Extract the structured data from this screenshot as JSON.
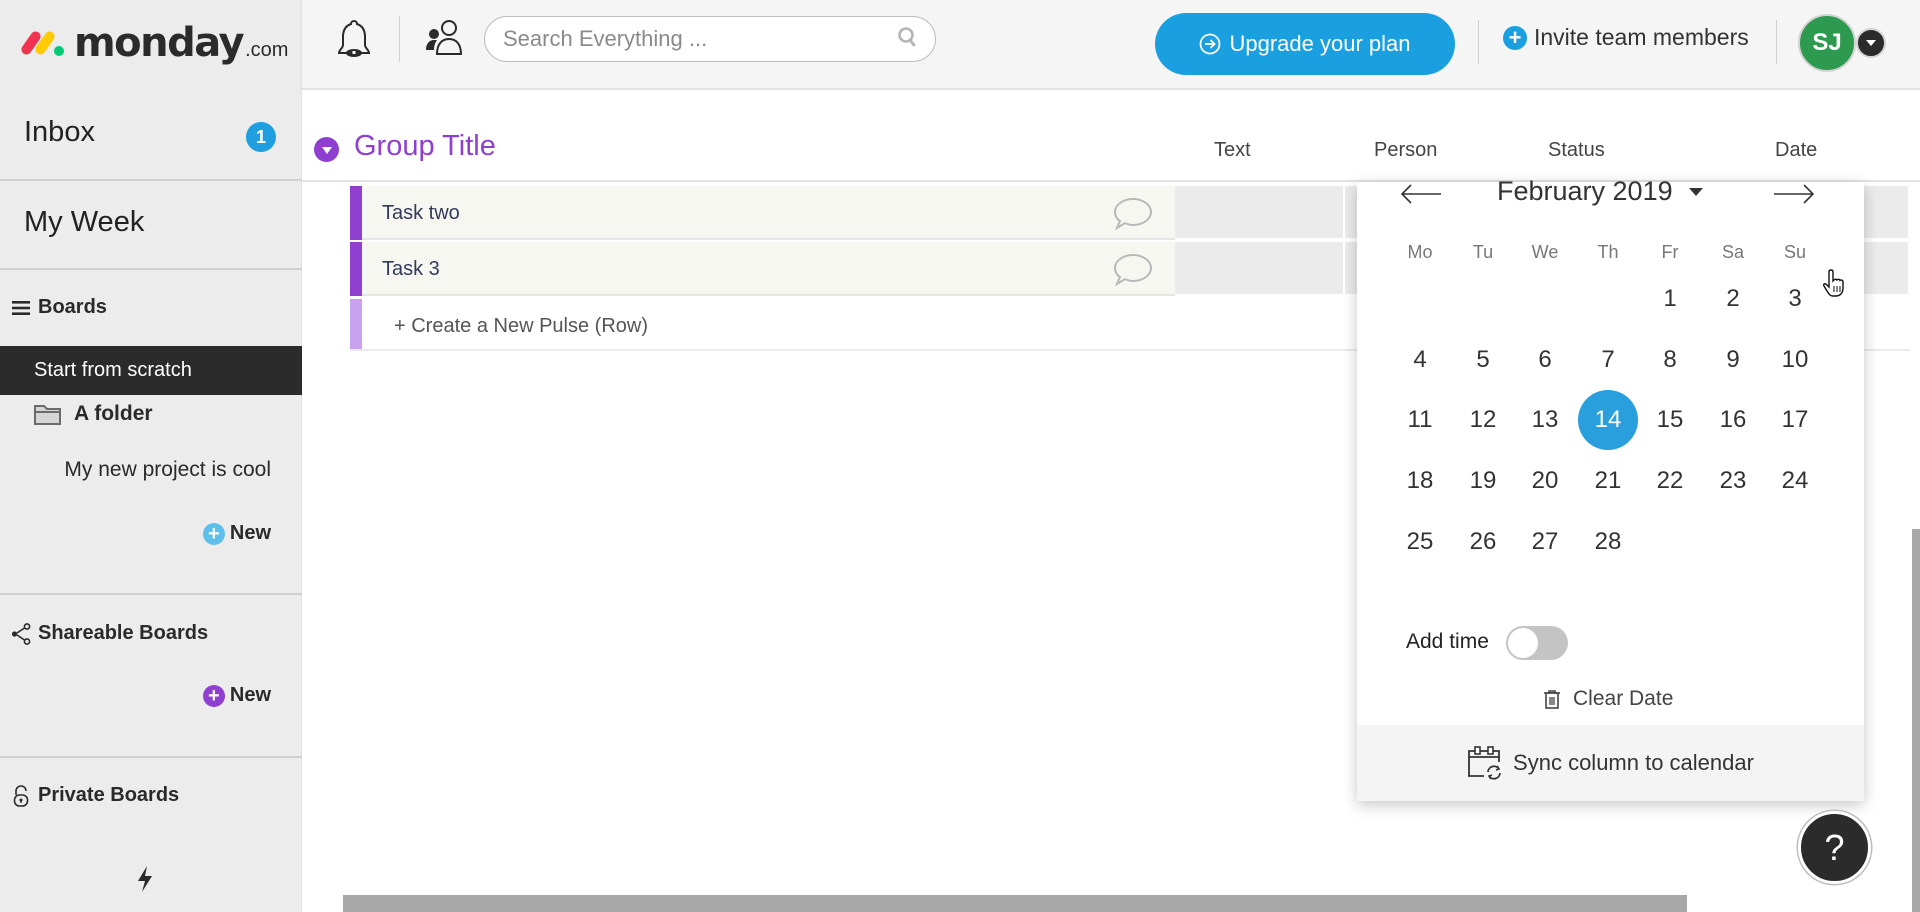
{
  "brand": {
    "name": "monday",
    "suffix": ".com",
    "colors": {
      "red": "#f0344f",
      "yellow": "#ffcb00",
      "green": "#00ca72"
    }
  },
  "sidebar": {
    "inbox": {
      "label": "Inbox",
      "badge": "1"
    },
    "my_week": {
      "label": "My Week"
    },
    "boards": {
      "label": "Boards",
      "items": [
        {
          "label": "Start from scratch",
          "selected": true
        }
      ],
      "folder": {
        "label": "A folder",
        "items": [
          {
            "label": "My new project is cool"
          }
        ]
      },
      "new_label": "New"
    },
    "shareable": {
      "label": "Shareable Boards",
      "new_label": "New"
    },
    "private": {
      "label": "Private Boards"
    }
  },
  "topbar": {
    "search": {
      "placeholder": "Search Everything ...",
      "value": ""
    },
    "upgrade_label": "Upgrade your plan",
    "invite_label": "Invite team members",
    "avatar_initials": "SJ"
  },
  "board": {
    "group": {
      "title": "Group Title",
      "color": "#8e3fd0"
    },
    "columns": [
      "Text",
      "Person",
      "Status",
      "Date"
    ],
    "rows": [
      {
        "name": "Task two"
      },
      {
        "name": "Task 3"
      }
    ],
    "create_row_label": "+ Create a New Pulse (Row)"
  },
  "datepicker": {
    "month_label": "February 2019",
    "weekdays": [
      "Mo",
      "Tu",
      "We",
      "Th",
      "Fr",
      "Sa",
      "Su"
    ],
    "weeks": [
      [
        "",
        "",
        "",
        "",
        "1",
        "2",
        "3"
      ],
      [
        "4",
        "5",
        "6",
        "7",
        "8",
        "9",
        "10"
      ],
      [
        "11",
        "12",
        "13",
        "14",
        "15",
        "16",
        "17"
      ],
      [
        "18",
        "19",
        "20",
        "21",
        "22",
        "23",
        "24"
      ],
      [
        "25",
        "26",
        "27",
        "28",
        "",
        "",
        ""
      ]
    ],
    "selected_day": "14",
    "add_time_label": "Add time",
    "add_time_enabled": false,
    "clear_label": "Clear Date",
    "sync_label": "Sync column to calendar",
    "accent": "#2a9fdd"
  },
  "help_label": "?"
}
